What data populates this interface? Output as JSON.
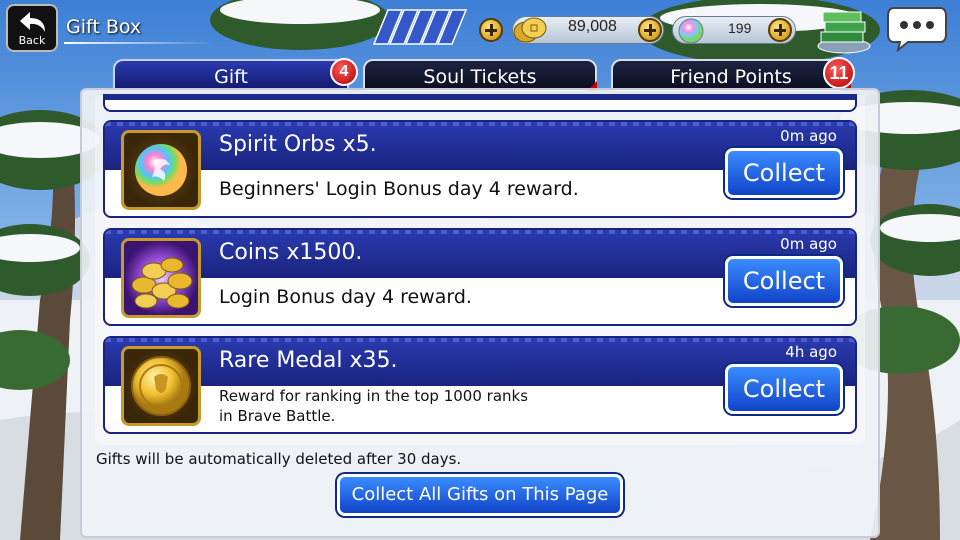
{
  "header": {
    "back_label": "Back",
    "title": "Gift Box",
    "coins": "89,008",
    "spirit_orbs": "199"
  },
  "tabs": [
    {
      "label": "Gift",
      "badge": "4",
      "active": true
    },
    {
      "label": "Soul Tickets",
      "badge": "",
      "active": false
    },
    {
      "label": "Friend Points",
      "badge": "11",
      "active": false
    }
  ],
  "gifts": [
    {
      "name": "Spirit Orbs x5.",
      "time": "0m ago",
      "description": "Beginners' Login Bonus day 4 reward.",
      "collect_label": "Collect",
      "icon": "spirit-orb-icon"
    },
    {
      "name": "Coins x1500.",
      "time": "0m ago",
      "description": "Login Bonus day 4 reward.",
      "collect_label": "Collect",
      "icon": "coins-icon"
    },
    {
      "name": "Rare Medal x35.",
      "time": "4h ago",
      "description_line1": "Reward for ranking in the top 1000 ranks",
      "description_line2": "in Brave Battle.",
      "collect_label": "Collect",
      "icon": "rare-medal-icon"
    }
  ],
  "footer": {
    "note": "Gifts will be automatically deleted after 30 days.",
    "collect_all_label": "Collect All Gifts on This Page"
  }
}
